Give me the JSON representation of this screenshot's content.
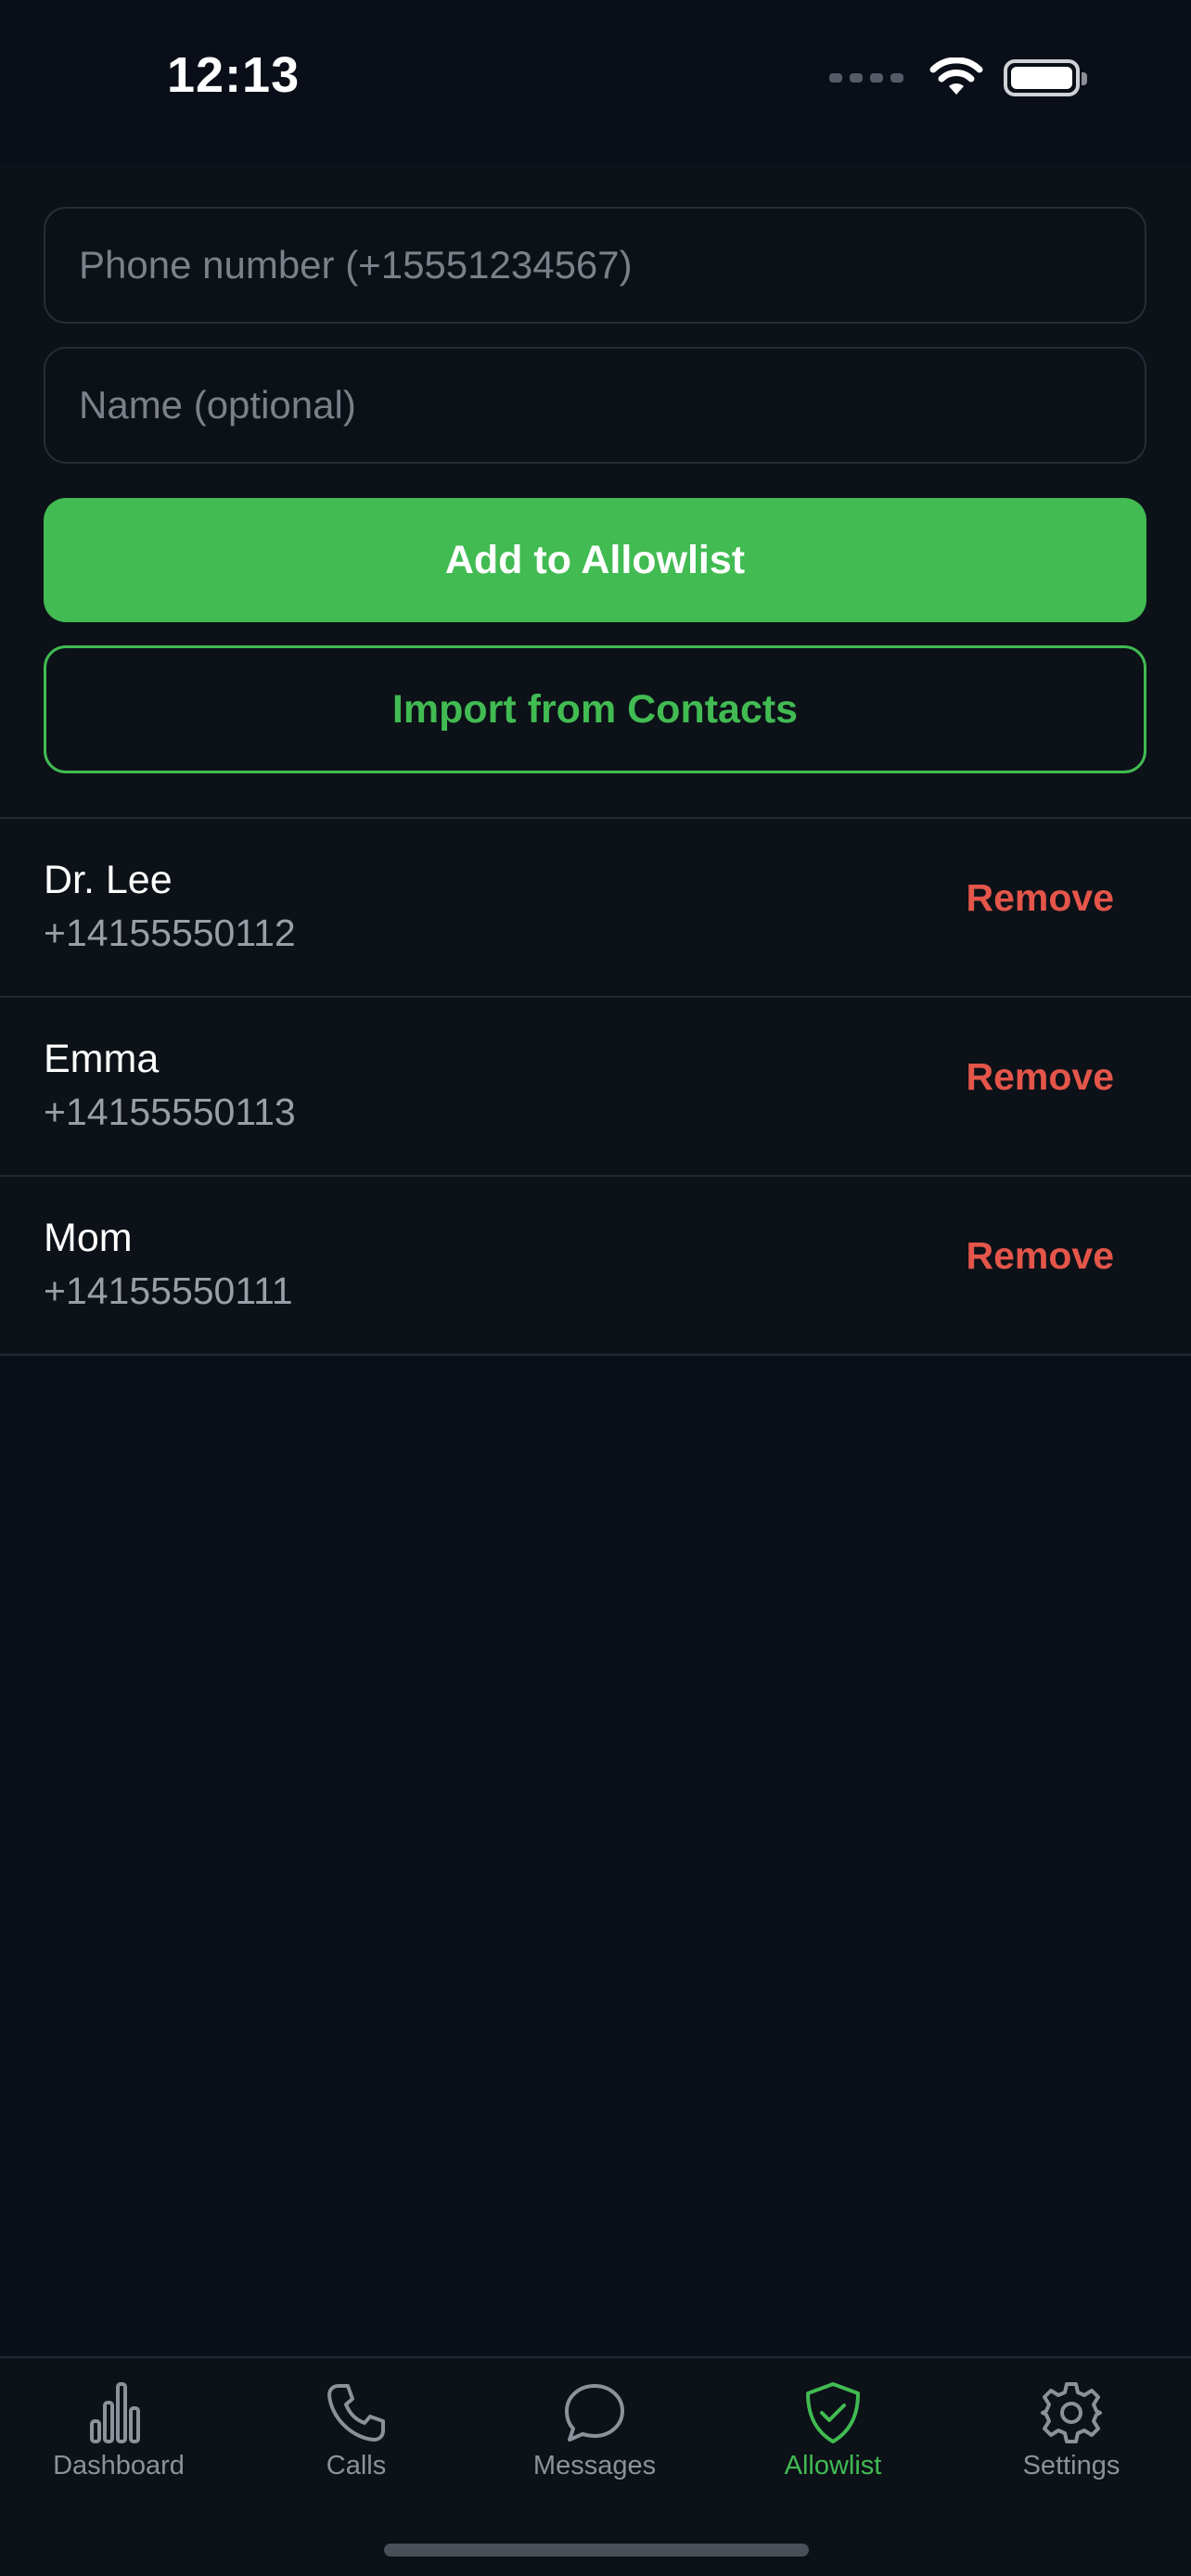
{
  "status_bar": {
    "time": "12:13"
  },
  "form": {
    "phone_placeholder": "Phone number (+15551234567)",
    "name_placeholder": "Name (optional)",
    "add_label": "Add to Allowlist",
    "import_label": "Import from Contacts"
  },
  "allowlist": [
    {
      "name": "Dr. Lee",
      "phone": "+14155550112",
      "action": "Remove"
    },
    {
      "name": "Emma",
      "phone": "+14155550113",
      "action": "Remove"
    },
    {
      "name": "Mom",
      "phone": "+14155550111",
      "action": "Remove"
    }
  ],
  "tabs": [
    {
      "label": "Dashboard",
      "icon": "bar-chart-icon",
      "active": false
    },
    {
      "label": "Calls",
      "icon": "phone-icon",
      "active": false
    },
    {
      "label": "Messages",
      "icon": "chat-bubble-icon",
      "active": false
    },
    {
      "label": "Allowlist",
      "icon": "shield-check-icon",
      "active": true
    },
    {
      "label": "Settings",
      "icon": "gear-icon",
      "active": false
    }
  ],
  "colors": {
    "accent": "#41bb52",
    "danger": "#e4554a",
    "background": "#0a0e18",
    "inactive_tab": "#8d929a"
  }
}
